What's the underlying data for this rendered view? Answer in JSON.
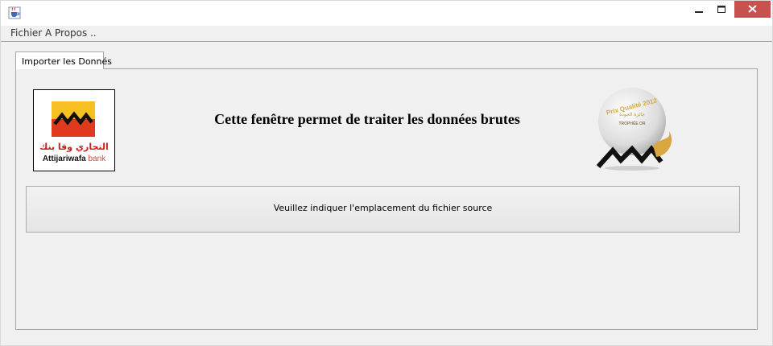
{
  "menubar": {
    "items": [
      {
        "label": "Fichier"
      },
      {
        "label": "A Propos .."
      }
    ]
  },
  "tabs": [
    {
      "label": "Importer les Donnés",
      "selected": true
    }
  ],
  "main": {
    "heading": "Cette fenêtre permet de traiter les données brutes",
    "source_button_label": "Veuillez indiquer l'emplacement du fichier source"
  },
  "logo": {
    "arabic_text": "التجاري وفا بنك",
    "brand_text": "Attijariwafa",
    "brand_suffix": "bank"
  },
  "award": {
    "text_top": "Prix Qualité 2012",
    "text_arabic": "جائزة الجودة",
    "text_trophy": "TROPHÉE OR"
  },
  "colors": {
    "accent": "#c7514e",
    "logo_yellow": "#f6c022",
    "logo_red": "#e03a1e",
    "award_gold": "#d9a640"
  },
  "icons": {
    "app": "java-coffee-cup-icon",
    "minimize": "minimize-icon",
    "maximize": "maximize-icon",
    "close": "close-icon"
  }
}
